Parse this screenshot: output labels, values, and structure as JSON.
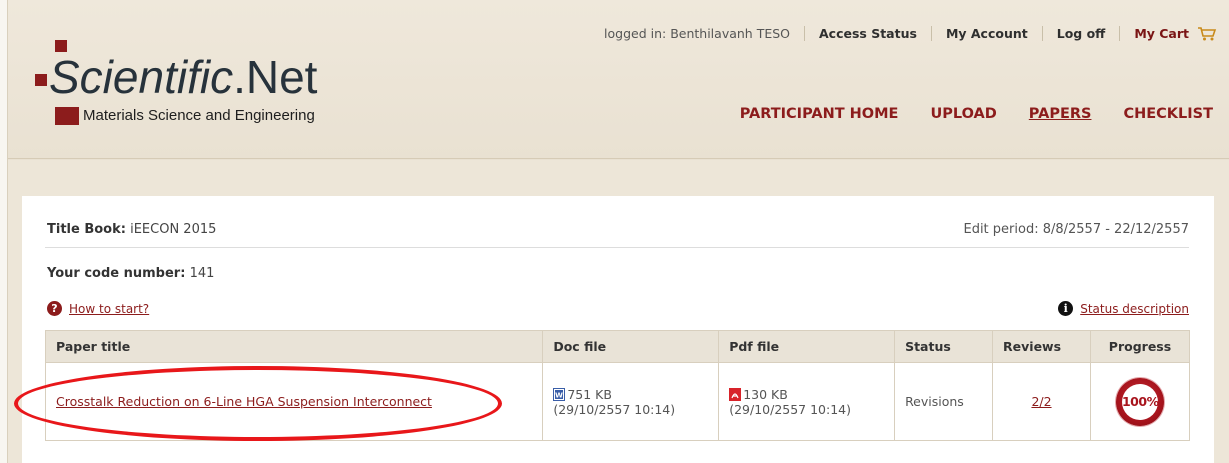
{
  "brand": {
    "name_italic": "Scientific",
    "name_rest": ".Net",
    "subtitle": "Materials Science and Engineering"
  },
  "toplinks": {
    "logged_in": "logged in: Benthilavanh TESO",
    "access_status": "Access Status",
    "my_account": "My Account",
    "log_off": "Log off",
    "my_cart": "My Cart"
  },
  "nav": {
    "participant_home": "PARTICIPANT HOME",
    "upload": "UPLOAD",
    "papers": "PAPERS",
    "checklist": "CHECKLIST",
    "active": "PAPERS"
  },
  "panel": {
    "title_book_label": "Title Book:",
    "title_book_value": "iEECON 2015",
    "edit_period": "Edit period: 8/8/2557 - 22/12/2557",
    "code_label": "Your code number:",
    "code_value": "141",
    "how_to_start": "How to start?",
    "status_description": "Status description"
  },
  "table": {
    "headers": {
      "paper_title": "Paper title",
      "doc_file": "Doc file",
      "pdf_file": "Pdf file",
      "status": "Status",
      "reviews": "Reviews",
      "progress": "Progress"
    },
    "rows": [
      {
        "title": "Crosstalk Reduction on 6-Line HGA Suspension Interconnect",
        "doc_size": "751 KB",
        "doc_date": "(29/10/2557 10:14)",
        "pdf_size": "130 KB",
        "pdf_date": "(29/10/2557 10:14)",
        "status": "Revisions",
        "reviews": "2/2",
        "progress": "100%"
      }
    ]
  },
  "colors": {
    "brand": "#8c1c1c",
    "annotation": "#e8171a",
    "background": "#ede6d8"
  }
}
